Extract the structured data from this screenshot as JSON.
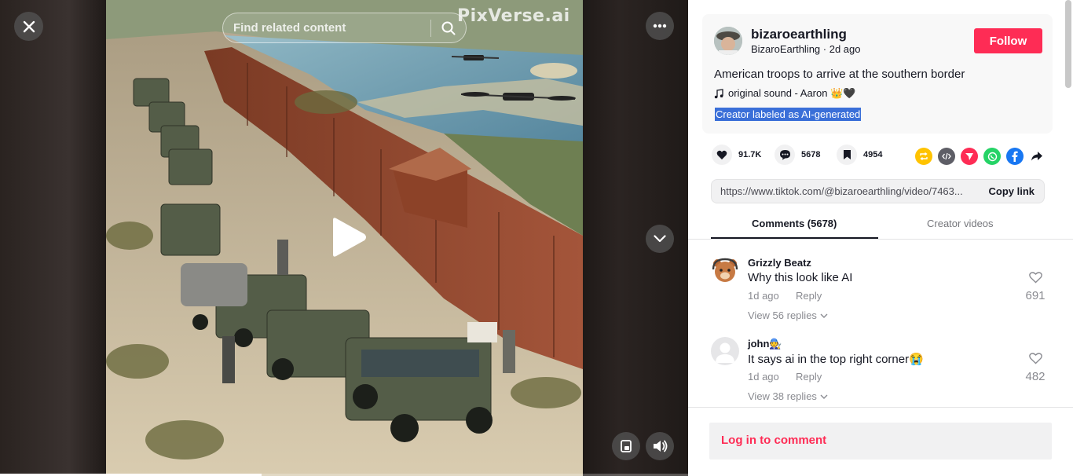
{
  "player": {
    "watermark": "PixVerse.ai",
    "search_placeholder": "Find related content",
    "progress_fraction": 0.38,
    "icons": [
      "close-icon",
      "search-icon",
      "more-icon",
      "chevron-down-icon",
      "play-icon",
      "pip-icon",
      "volume-icon"
    ]
  },
  "post": {
    "username": "bizaroearthling",
    "nickname": "BizaroEarthling",
    "separator": " · ",
    "time": "2d ago",
    "follow_label": "Follow",
    "description": "American troops to arrive at the southern border",
    "sound": "original sound - Aaron 👑🖤",
    "ai_label": "Creator labeled as AI-generated"
  },
  "stats": {
    "likes": "91.7K",
    "comments": "5678",
    "saves": "4954"
  },
  "share": {
    "link_url": "https://www.tiktok.com/@bizaroearthling/video/7463...",
    "copy_label": "Copy link",
    "icons": [
      "repost-icon",
      "embed-icon",
      "send-icon",
      "whatsapp-icon",
      "facebook-icon",
      "share-arrow-icon"
    ],
    "colors": {
      "repost": "#ffc300",
      "embed": "#5e5e66",
      "send": "#fe2c55",
      "whatsapp": "#25d366",
      "facebook": "#1877f2"
    }
  },
  "tabs": [
    {
      "label": "Comments (5678)",
      "active": true
    },
    {
      "label": "Creator videos",
      "active": false
    }
  ],
  "comments": [
    {
      "name": "Grizzly Beatz",
      "text": "Why this look like AI",
      "time": "1d ago",
      "reply": "Reply",
      "view_replies": "View 56 replies",
      "likes": "691"
    },
    {
      "name": "john🧑‍🔧",
      "text": "It says ai in the top right corner😭",
      "time": "1d ago",
      "reply": "Reply",
      "view_replies": "View 38 replies",
      "likes": "482"
    }
  ],
  "login": {
    "label": "Log in to comment"
  },
  "accent_color": "#fe2c55"
}
